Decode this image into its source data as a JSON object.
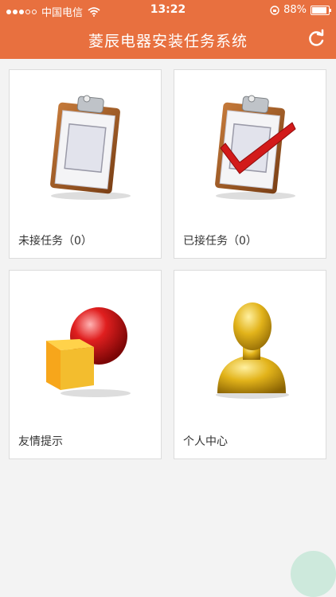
{
  "status": {
    "carrier": "中国电信",
    "time": "13:22",
    "battery": "88%",
    "battery_level": 0.88
  },
  "nav": {
    "title": "菱辰电器安装任务系统",
    "refresh_icon": "refresh-icon"
  },
  "tiles": [
    {
      "label": "未接任务（0）",
      "icon": "clipboard-icon"
    },
    {
      "label": "已接任务（0）",
      "icon": "clipboard-check-icon"
    },
    {
      "label": "友情提示",
      "icon": "shapes-icon"
    },
    {
      "label": "个人中心",
      "icon": "user-bust-icon"
    }
  ],
  "colors": {
    "brand": "#e8703f",
    "background": "#f3f3f3"
  }
}
